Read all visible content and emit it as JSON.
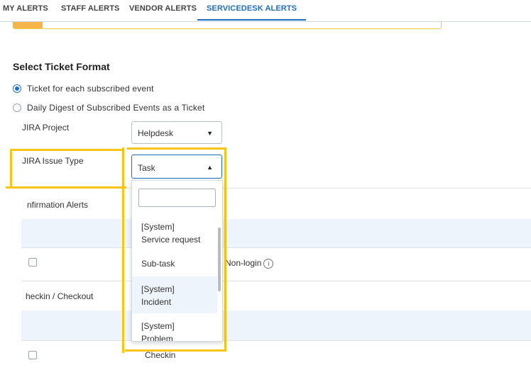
{
  "tabs": [
    {
      "label": "MY ALERTS"
    },
    {
      "label": "STAFF ALERTS"
    },
    {
      "label": "VENDOR ALERTS"
    },
    {
      "label": "SERVICEDESK ALERTS"
    }
  ],
  "form": {
    "section_title": "Select Ticket Format",
    "radio_options": [
      {
        "label": "Ticket for each subscribed event",
        "checked": true
      },
      {
        "label": "Daily Digest of Subscribed Events as a Ticket",
        "checked": false
      }
    ],
    "jira_project": {
      "label": "JIRA Project",
      "value": "Helpdesk"
    },
    "jira_issue_type": {
      "label": "JIRA Issue Type",
      "value": "Task"
    }
  },
  "dropdown": {
    "search_value": "",
    "options": [
      {
        "label": "[System]\nService request"
      },
      {
        "label": "Sub-task"
      },
      {
        "label": "[System]\nIncident"
      },
      {
        "label": "[System]\nProblem"
      }
    ]
  },
  "background": {
    "row1_label": "nfirmation Alerts",
    "row2_text": "Non-login",
    "row3_label": "heckin / Checkout",
    "row4_text": "Checkin"
  },
  "colors": {
    "accent": "#1f6fbf",
    "highlight": "#f7c518",
    "notice": "#f6b54a"
  }
}
